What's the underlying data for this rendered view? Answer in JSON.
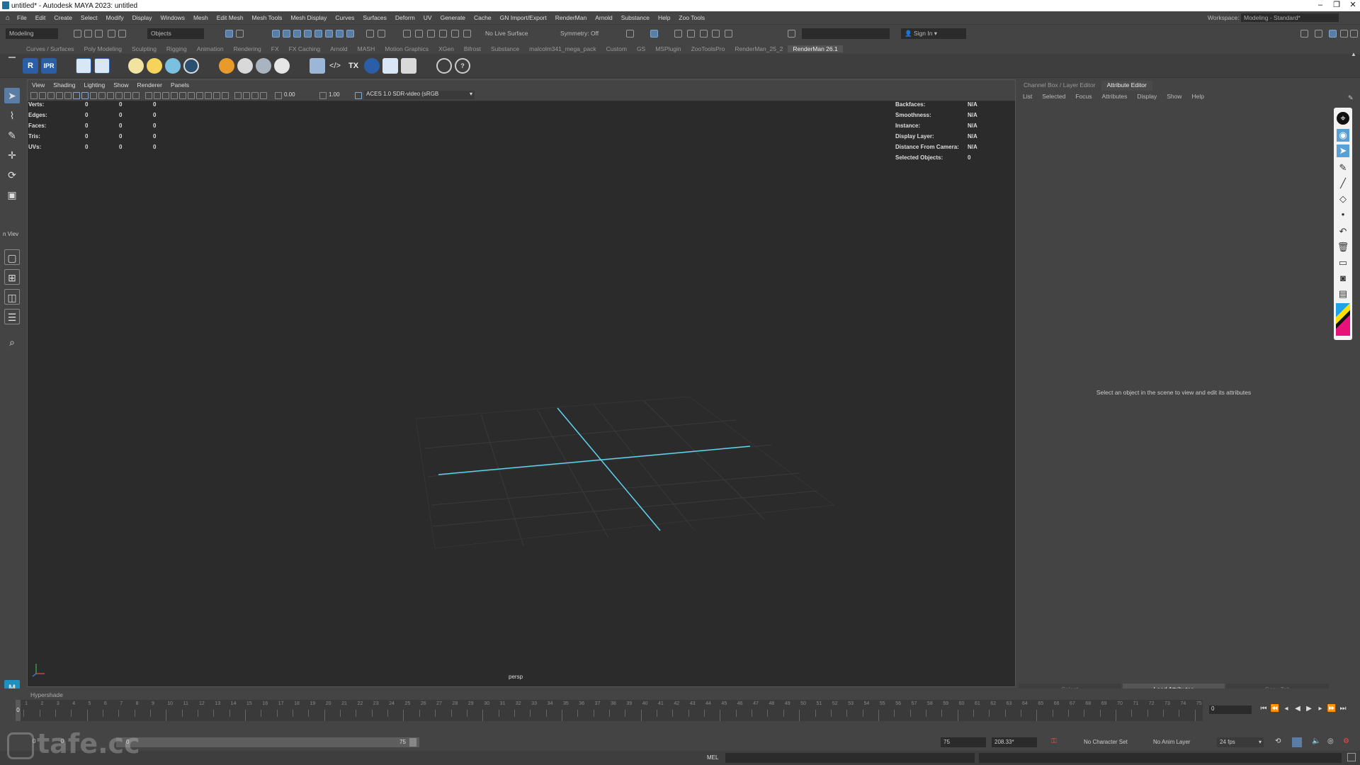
{
  "window": {
    "title": "untitled* - Autodesk MAYA 2023: untitled",
    "controls": [
      "–",
      "❐",
      "✕"
    ]
  },
  "menubar": {
    "items": [
      "File",
      "Edit",
      "Create",
      "Select",
      "Modify",
      "Display",
      "Windows",
      "Mesh",
      "Edit Mesh",
      "Mesh Tools",
      "Mesh Display",
      "Curves",
      "Surfaces",
      "Deform",
      "UV",
      "Generate",
      "Cache",
      "GN Import/Export",
      "RenderMan",
      "Arnold",
      "Substance",
      "Help",
      "Zoo Tools"
    ],
    "workspace_label": "Workspace:",
    "workspace_value": "Modeling - Standard*"
  },
  "statusline": {
    "mode": "Modeling",
    "objects": "Objects",
    "live_surface": "No Live Surface",
    "symmetry": "Symmetry: Off",
    "sign_in": "Sign In"
  },
  "shelf": {
    "tabs": [
      "Curves / Surfaces",
      "Poly Modeling",
      "Sculpting",
      "Rigging",
      "Animation",
      "Rendering",
      "FX",
      "FX Caching",
      "Arnold",
      "MASH",
      "Motion Graphics",
      "XGen",
      "Bifrost",
      "Substance",
      "malcolm341_mega_pack",
      "Custom",
      "GS",
      "MSPlugin",
      "ZooToolsPro",
      "RenderMan_25_2",
      "RenderMan 26.1"
    ],
    "active_tab": "RenderMan 26.1",
    "icon_labels": [
      "R",
      "IPR",
      "TX"
    ]
  },
  "toolbox": {
    "label": "n Viev"
  },
  "viewport": {
    "menu": [
      "View",
      "Shading",
      "Lighting",
      "Show",
      "Renderer",
      "Panels"
    ],
    "exposure": "0.00",
    "gamma": "1.00",
    "colorspace": "ACES 1.0 SDR-video (sRGB",
    "camera": "persp",
    "stats_left": [
      {
        "label": "Verts:",
        "v1": "0",
        "v2": "0",
        "v3": "0"
      },
      {
        "label": "Edges:",
        "v1": "0",
        "v2": "0",
        "v3": "0"
      },
      {
        "label": "Faces:",
        "v1": "0",
        "v2": "0",
        "v3": "0"
      },
      {
        "label": "Tris:",
        "v1": "0",
        "v2": "0",
        "v3": "0"
      },
      {
        "label": "UVs:",
        "v1": "0",
        "v2": "0",
        "v3": "0"
      }
    ],
    "stats_right": [
      {
        "label": "Backfaces:",
        "value": "N/A"
      },
      {
        "label": "Smoothness:",
        "value": "N/A"
      },
      {
        "label": "Instance:",
        "value": "N/A"
      },
      {
        "label": "Display Layer:",
        "value": "N/A"
      },
      {
        "label": "Distance From Camera:",
        "value": "N/A"
      },
      {
        "label": "Selected Objects:",
        "value": "0"
      }
    ],
    "axis_color": "#5fd4f0"
  },
  "attribute_editor": {
    "tabs": [
      "Channel Box / Layer Editor",
      "Attribute Editor"
    ],
    "active_tab": "Attribute Editor",
    "menu": [
      "List",
      "Selected",
      "Focus",
      "Attributes",
      "Display",
      "Show",
      "Help"
    ],
    "message": "Select an object in the scene to view and edit its attributes",
    "buttons": [
      "Select",
      "Load Attributes",
      "Copy Tab"
    ]
  },
  "timeline": {
    "hypershade_label": "Hypershade",
    "current_frame": "0",
    "range_start_outer": "0",
    "range_start": "0",
    "range_end": "75",
    "range_end_inner": "75",
    "range_end_outer": "75",
    "zoom": "208.33*",
    "character_set": "No Character Set",
    "anim_layer": "No Anim Layer",
    "fps": "24 fps",
    "frame_field": "0"
  },
  "cmdline": {
    "label": "MEL"
  },
  "watermark": "tafe.cc"
}
